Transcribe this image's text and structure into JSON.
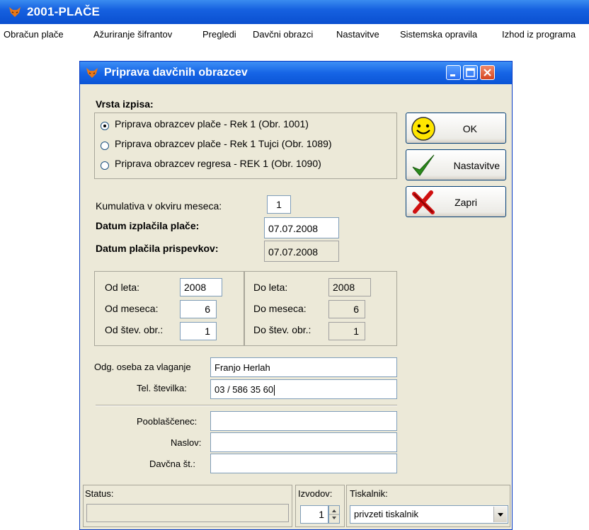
{
  "app": {
    "title": "2001-PLAČE"
  },
  "menu": [
    "Obračun plače",
    "Ažuriranje šifrantov",
    "Pregledi",
    "Davčni obrazci",
    "Nastavitve",
    "Sistemska opravila",
    "Izhod iz programa"
  ],
  "dialog": {
    "title": "Priprava davčnih obrazcev",
    "vrsta": {
      "label": "Vrsta izpisa:",
      "options": [
        {
          "label": "Priprava obrazcev plače - Rek 1 (Obr. 1001)",
          "selected": true
        },
        {
          "label": "Priprava obrazcev plače - Rek 1 Tujci (Obr. 1089)",
          "selected": false
        },
        {
          "label": "Priprava obrazcev regresa - REK 1 (Obr. 1090)",
          "selected": false
        }
      ]
    },
    "buttons": {
      "ok": "OK",
      "nastavitve": "Nastavitve",
      "zapri": "Zapri"
    },
    "kumulativa": {
      "label": "Kumulativa v okviru meseca:",
      "value": "1"
    },
    "datum_izplacila": {
      "label": "Datum izplačila plače:",
      "value": "07.07.2008"
    },
    "datum_placila": {
      "label": "Datum plačila prispevkov:",
      "value": "07.07.2008"
    },
    "od": {
      "leta_label": "Od leta:",
      "leta": "2008",
      "meseca_label": "Od meseca:",
      "meseca": "6",
      "stev_label": "Od štev. obr.:",
      "stev": "1"
    },
    "do": {
      "leta_label": "Do leta:",
      "leta": "2008",
      "meseca_label": "Do meseca:",
      "meseca": "6",
      "stev_label": "Do štev. obr.:",
      "stev": "1"
    },
    "odg_oseba": {
      "label": "Odg. oseba za vlaganje",
      "value": "Franjo Herlah"
    },
    "tel": {
      "label": "Tel. številka:",
      "value": "03 / 586 35 60"
    },
    "pooblascenec": {
      "label": "Pooblaščenec:",
      "value": ""
    },
    "naslov": {
      "label": "Naslov:",
      "value": ""
    },
    "davcna": {
      "label": "Davčna št.:",
      "value": ""
    },
    "status": {
      "label": "Status:",
      "value": ""
    },
    "izvodov": {
      "label": "Izvodov:",
      "value": "1"
    },
    "tiskalnik": {
      "label": "Tiskalnik:",
      "value": "privzeti tiskalnik"
    }
  },
  "colors": {
    "titlebar": "#0a4fd0",
    "dialog_bg": "#ece9d8",
    "close": "#d6451f"
  },
  "icons": [
    "fox-icon",
    "smiley-icon",
    "checkmark-icon",
    "red-x-icon",
    "minimize-icon",
    "maximize-icon",
    "close-icon",
    "spin-up-icon",
    "spin-down-icon",
    "dropdown-arrow-icon"
  ]
}
